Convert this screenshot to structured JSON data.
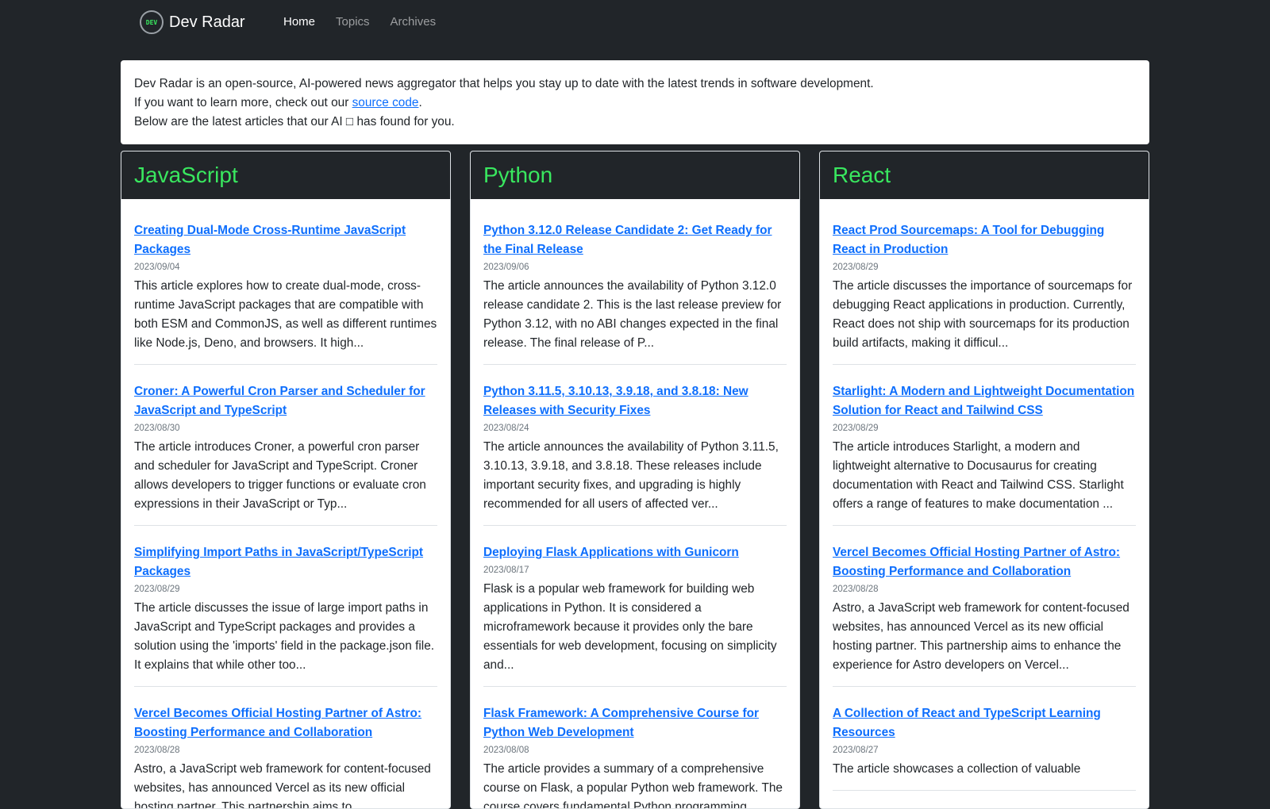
{
  "nav": {
    "logo_text": "DEV",
    "brand": "Dev Radar",
    "links": [
      "Home",
      "Topics",
      "Archives"
    ],
    "active": "Home"
  },
  "intro": {
    "line1": "Dev Radar is an open-source, AI-powered news aggregator that helps you stay up to date with the latest trends in software development.",
    "line2_before": "If you want to learn more, check out our ",
    "line2_link": "source code",
    "line2_after": ".",
    "line3": "Below are the latest articles that our AI □ has found for you."
  },
  "columns": [
    {
      "title": "JavaScript",
      "articles": [
        {
          "title": "Creating Dual-Mode Cross-Runtime JavaScript Packages",
          "date": "2023/09/04",
          "summary": "This article explores how to create dual-mode, cross-runtime JavaScript packages that are compatible with both ESM and CommonJS, as well as different runtimes like Node.js, Deno, and browsers. It high..."
        },
        {
          "title": "Croner: A Powerful Cron Parser and Scheduler for JavaScript and TypeScript",
          "date": "2023/08/30",
          "summary": "The article introduces Croner, a powerful cron parser and scheduler for JavaScript and TypeScript. Croner allows developers to trigger functions or evaluate cron expressions in their JavaScript or Typ..."
        },
        {
          "title": "Simplifying Import Paths in JavaScript/TypeScript Packages",
          "date": "2023/08/29",
          "summary": "The article discusses the issue of large import paths in JavaScript and TypeScript packages and provides a solution using the 'imports' field in the package.json file. It explains that while other too..."
        },
        {
          "title": "Vercel Becomes Official Hosting Partner of Astro: Boosting Performance and Collaboration",
          "date": "2023/08/28",
          "summary": "Astro, a JavaScript web framework for content-focused websites, has announced Vercel as its new official hosting partner. This partnership aims to"
        }
      ]
    },
    {
      "title": "Python",
      "articles": [
        {
          "title": "Python 3.12.0 Release Candidate 2: Get Ready for the Final Release",
          "date": "2023/09/06",
          "summary": "The article announces the availability of Python 3.12.0 release candidate 2. This is the last release preview for Python 3.12, with no ABI changes expected in the final release. The final release of P..."
        },
        {
          "title": "Python 3.11.5, 3.10.13, 3.9.18, and 3.8.18: New Releases with Security Fixes",
          "date": "2023/08/24",
          "summary": "The article announces the availability of Python 3.11.5, 3.10.13, 3.9.18, and 3.8.18. These releases include important security fixes, and upgrading is highly recommended for all users of affected ver..."
        },
        {
          "title": "Deploying Flask Applications with Gunicorn",
          "date": "2023/08/17",
          "summary": "Flask is a popular web framework for building web applications in Python. It is considered a microframework because it provides only the bare essentials for web development, focusing on simplicity and..."
        },
        {
          "title": "Flask Framework: A Comprehensive Course for Python Web Development",
          "date": "2023/08/08",
          "summary": "The article provides a summary of a comprehensive course on Flask, a popular Python web framework. The course covers fundamental Python programming"
        }
      ]
    },
    {
      "title": "React",
      "articles": [
        {
          "title": "React Prod Sourcemaps: A Tool for Debugging React in Production",
          "date": "2023/08/29",
          "summary": "The article discusses the importance of sourcemaps for debugging React applications in production. Currently, React does not ship with sourcemaps for its production build artifacts, making it difficul..."
        },
        {
          "title": "Starlight: A Modern and Lightweight Documentation Solution for React and Tailwind CSS",
          "date": "2023/08/29",
          "summary": "The article introduces Starlight, a modern and lightweight alternative to Docusaurus for creating documentation with React and Tailwind CSS. Starlight offers a range of features to make documentation ..."
        },
        {
          "title": "Vercel Becomes Official Hosting Partner of Astro: Boosting Performance and Collaboration",
          "date": "2023/08/28",
          "summary": "Astro, a JavaScript web framework for content-focused websites, has announced Vercel as its new official hosting partner. This partnership aims to enhance the experience for Astro developers on Vercel..."
        },
        {
          "title": "A Collection of React and TypeScript Learning Resources",
          "date": "2023/08/27",
          "summary": "The article showcases a collection of valuable"
        }
      ]
    }
  ],
  "colors": {
    "page_bg": "#212529",
    "accent_green": "#39e75f",
    "link_blue": "#0d6efd"
  }
}
